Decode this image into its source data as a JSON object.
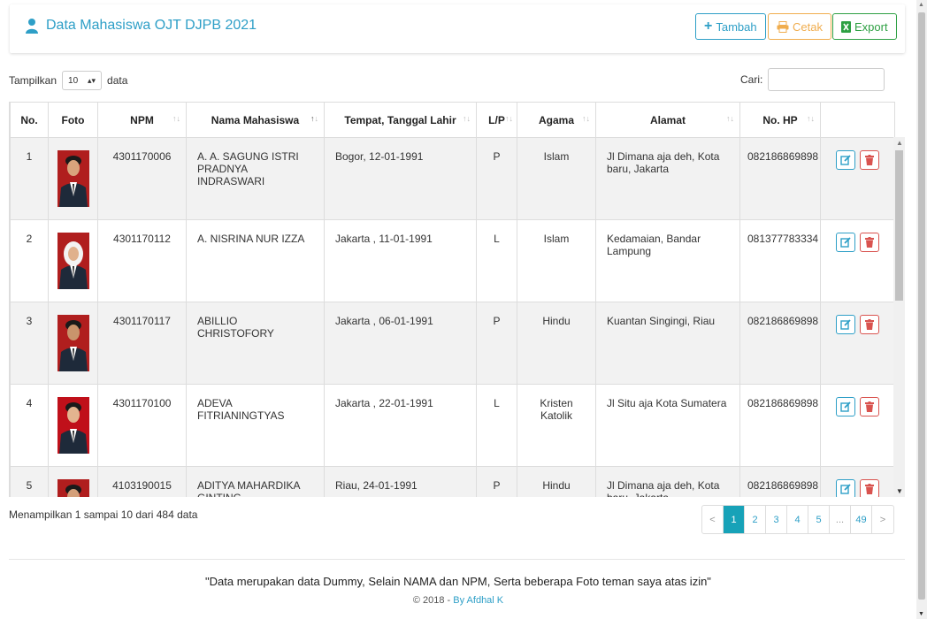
{
  "header": {
    "title": "Data Mahasiswa OJT DJPB 2021",
    "buttons": {
      "tambah": "Tambah",
      "cetak": "Cetak",
      "export": "Export"
    }
  },
  "controls": {
    "show_prefix": "Tampilkan",
    "show_value": "10",
    "show_suffix": "data",
    "search_label": "Cari:",
    "search_value": ""
  },
  "table": {
    "columns": [
      "No.",
      "Foto",
      "NPM",
      "Nama Mahasiswa",
      "Tempat, Tanggal Lahir",
      "L/P",
      "Agama",
      "Alamat",
      "No. HP",
      ""
    ],
    "rows": [
      {
        "no": "1",
        "npm": "4301170006",
        "nama": "A. A. SAGUNG ISTRI PRADNYA INDRASWARI",
        "ttl": "Bogor, 12-01-1991",
        "lp": "P",
        "agama": "Islam",
        "alamat": "Jl Dimana aja deh, Kota baru, Jakarta",
        "hp": "082186869898"
      },
      {
        "no": "2",
        "npm": "4301170112",
        "nama": "A. NISRINA NUR IZZA",
        "ttl": "Jakarta , 11-01-1991",
        "lp": "L",
        "agama": "Islam",
        "alamat": "Kedamaian, Bandar Lampung",
        "hp": "081377783334"
      },
      {
        "no": "3",
        "npm": "4301170117",
        "nama": "ABILLIO CHRISTOFORY",
        "ttl": "Jakarta , 06-01-1991",
        "lp": "P",
        "agama": "Hindu",
        "alamat": "Kuantan Singingi, Riau",
        "hp": "082186869898"
      },
      {
        "no": "4",
        "npm": "4301170100",
        "nama": "ADEVA FITRIANINGTYAS",
        "ttl": "Jakarta , 22-01-1991",
        "lp": "L",
        "agama": "Kristen Katolik",
        "alamat": "Jl Situ aja Kota Sumatera",
        "hp": "082186869898"
      },
      {
        "no": "5",
        "npm": "4103190015",
        "nama": "ADITYA MAHARDIKA GINTING",
        "ttl": "Riau, 24-01-1991",
        "lp": "P",
        "agama": "Hindu",
        "alamat": "Jl Dimana aja deh, Kota baru, Jakarta",
        "hp": "082186869898"
      }
    ]
  },
  "info": "Menampilkan 1 sampai 10 dari 484 data",
  "pagination": [
    "<",
    "1",
    "2",
    "3",
    "4",
    "5",
    "...",
    "49",
    ">"
  ],
  "footer": {
    "quote": "\"Data merupakan data Dummy, Selain NAMA dan NPM, Serta beberapa Foto teman saya atas izin\"",
    "copy_prefix": "© 2018 - ",
    "copy_link": "By Afdhal K"
  },
  "colors": {
    "accent": "#2e9fc7",
    "warning": "#f0ad4e",
    "success": "#2ea043",
    "danger": "#d9534f",
    "active_page": "#17a2b8"
  }
}
